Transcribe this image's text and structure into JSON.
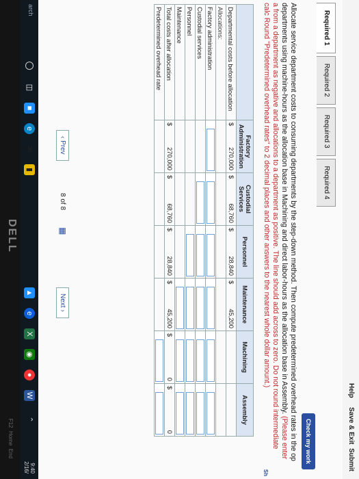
{
  "header": {
    "help": "Help",
    "save_exit": "Save & Exit",
    "submit": "Submit"
  },
  "tabs": [
    "Required 1",
    "Required 2",
    "Required 3",
    "Required 4"
  ],
  "check_button": "Check my work",
  "instructions": {
    "main": "Allocate service department costs to consuming departments by the step-down method. Then compute predetermined overhead rates in the op departments using machine-hours as the allocation base in Machining and direct labor-hours as the allocation base in Assembly. ",
    "note": "(Please enter a from a department as negative and allocations to a department as positive. The line should add across to zero. Do not round intermediate calc Round \"Predetermined overhead rates\" to 2 decimal places and other answers to the nearest whole dollar amount.)"
  },
  "show_label": "Sh",
  "table": {
    "headers": [
      "Factory Administration",
      "Custodial Services",
      "Personnel",
      "Maintenance",
      "Machining",
      "Assembly"
    ],
    "rows": {
      "before": {
        "label": "Departmental costs before allocation",
        "values": [
          "270,000",
          "68,760",
          "28,840",
          "45,200",
          "",
          ""
        ]
      },
      "allocations": {
        "label": "Allocations:"
      },
      "factory": {
        "label": "Factory administration"
      },
      "custodial": {
        "label": "Custodial services"
      },
      "personnel": {
        "label": "Personnel"
      },
      "maintenance": {
        "label": "Maintenance"
      },
      "after": {
        "label": "Total costs after allocation",
        "values": [
          "270,000",
          "68,760",
          "28,840",
          "45,200",
          "0",
          "0"
        ]
      },
      "rate": {
        "label": "Predetermined overhead rate"
      }
    },
    "currency": "$"
  },
  "pager": {
    "prev": "Prev",
    "page": "8",
    "of": "of",
    "total": "8",
    "next": "Next"
  },
  "taskbar": {
    "search": "arch",
    "time": "9:40",
    "date": "2/16/"
  },
  "bezel": {
    "logo": "DELL",
    "key1": "F12",
    "key2": "Home",
    "key3": "End"
  }
}
